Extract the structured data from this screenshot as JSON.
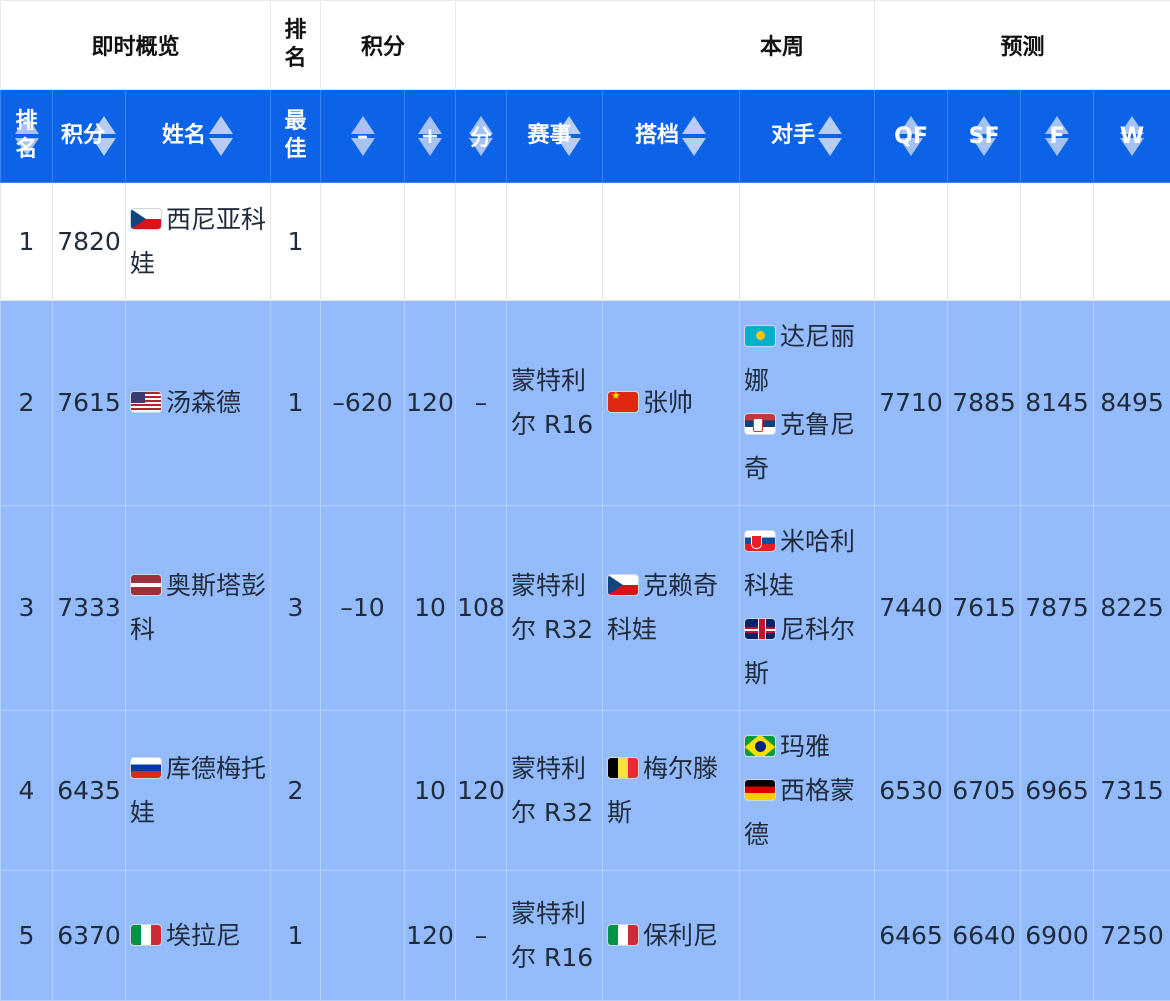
{
  "groups": {
    "overview": "即时概览",
    "rank": "排名",
    "points": "积分",
    "thisweek": "本周",
    "forecast": "预测"
  },
  "columns": {
    "rank": "排名",
    "points": "积分",
    "name": "姓名",
    "best": "最佳",
    "minus": "–",
    "plus": "+",
    "score": "分",
    "event": "赛事",
    "partner": "搭档",
    "opponent": "对手",
    "qf": "QF",
    "sf": "SF",
    "f": "F",
    "w": "W"
  },
  "rows": [
    {
      "rank": "1",
      "points": "7820",
      "flag": "cz",
      "name": "西尼亚科娃",
      "best": "1",
      "minus": "",
      "plus": "",
      "score": "",
      "event": "",
      "partner_flag": "",
      "partner": "",
      "opponents": [],
      "qf": "",
      "sf": "",
      "f": "",
      "w": ""
    },
    {
      "rank": "2",
      "points": "7615",
      "flag": "us",
      "name": "汤森德",
      "best": "1",
      "minus": "–620",
      "plus": "120",
      "score": "–",
      "event": "蒙特利尔 R16",
      "partner_flag": "cn",
      "partner": "张帅",
      "opponents": [
        {
          "flag": "kz",
          "name": "达尼丽娜"
        },
        {
          "flag": "rs",
          "name": "克鲁尼奇"
        }
      ],
      "qf": "7710",
      "sf": "7885",
      "f": "8145",
      "w": "8495"
    },
    {
      "rank": "3",
      "points": "7333",
      "flag": "lv",
      "name": "奥斯塔彭科",
      "best": "3",
      "minus": "–10",
      "plus": "10",
      "score": "108",
      "event": "蒙特利尔 R32",
      "partner_flag": "cz",
      "partner": "克赖奇科娃",
      "opponents": [
        {
          "flag": "sk",
          "name": "米哈利科娃"
        },
        {
          "flag": "gb",
          "name": "尼科尔斯"
        }
      ],
      "qf": "7440",
      "sf": "7615",
      "f": "7875",
      "w": "8225"
    },
    {
      "rank": "4",
      "points": "6435",
      "flag": "ru",
      "name": "库德梅托娃",
      "best": "2",
      "minus": "",
      "plus": "10",
      "score": "120",
      "event": "蒙特利尔 R32",
      "partner_flag": "be",
      "partner": "梅尔滕斯",
      "opponents": [
        {
          "flag": "br",
          "name": "玛雅"
        },
        {
          "flag": "de",
          "name": "西格蒙德"
        }
      ],
      "qf": "6530",
      "sf": "6705",
      "f": "6965",
      "w": "7315"
    },
    {
      "rank": "5",
      "points": "6370",
      "flag": "it",
      "name": "埃拉尼",
      "best": "1",
      "minus": "",
      "plus": "120",
      "score": "–",
      "event": "蒙特利尔 R16",
      "partner_flag": "it",
      "partner": "保利尼",
      "opponents": [],
      "qf": "6465",
      "sf": "6640",
      "f": "6900",
      "w": "7250"
    }
  ]
}
